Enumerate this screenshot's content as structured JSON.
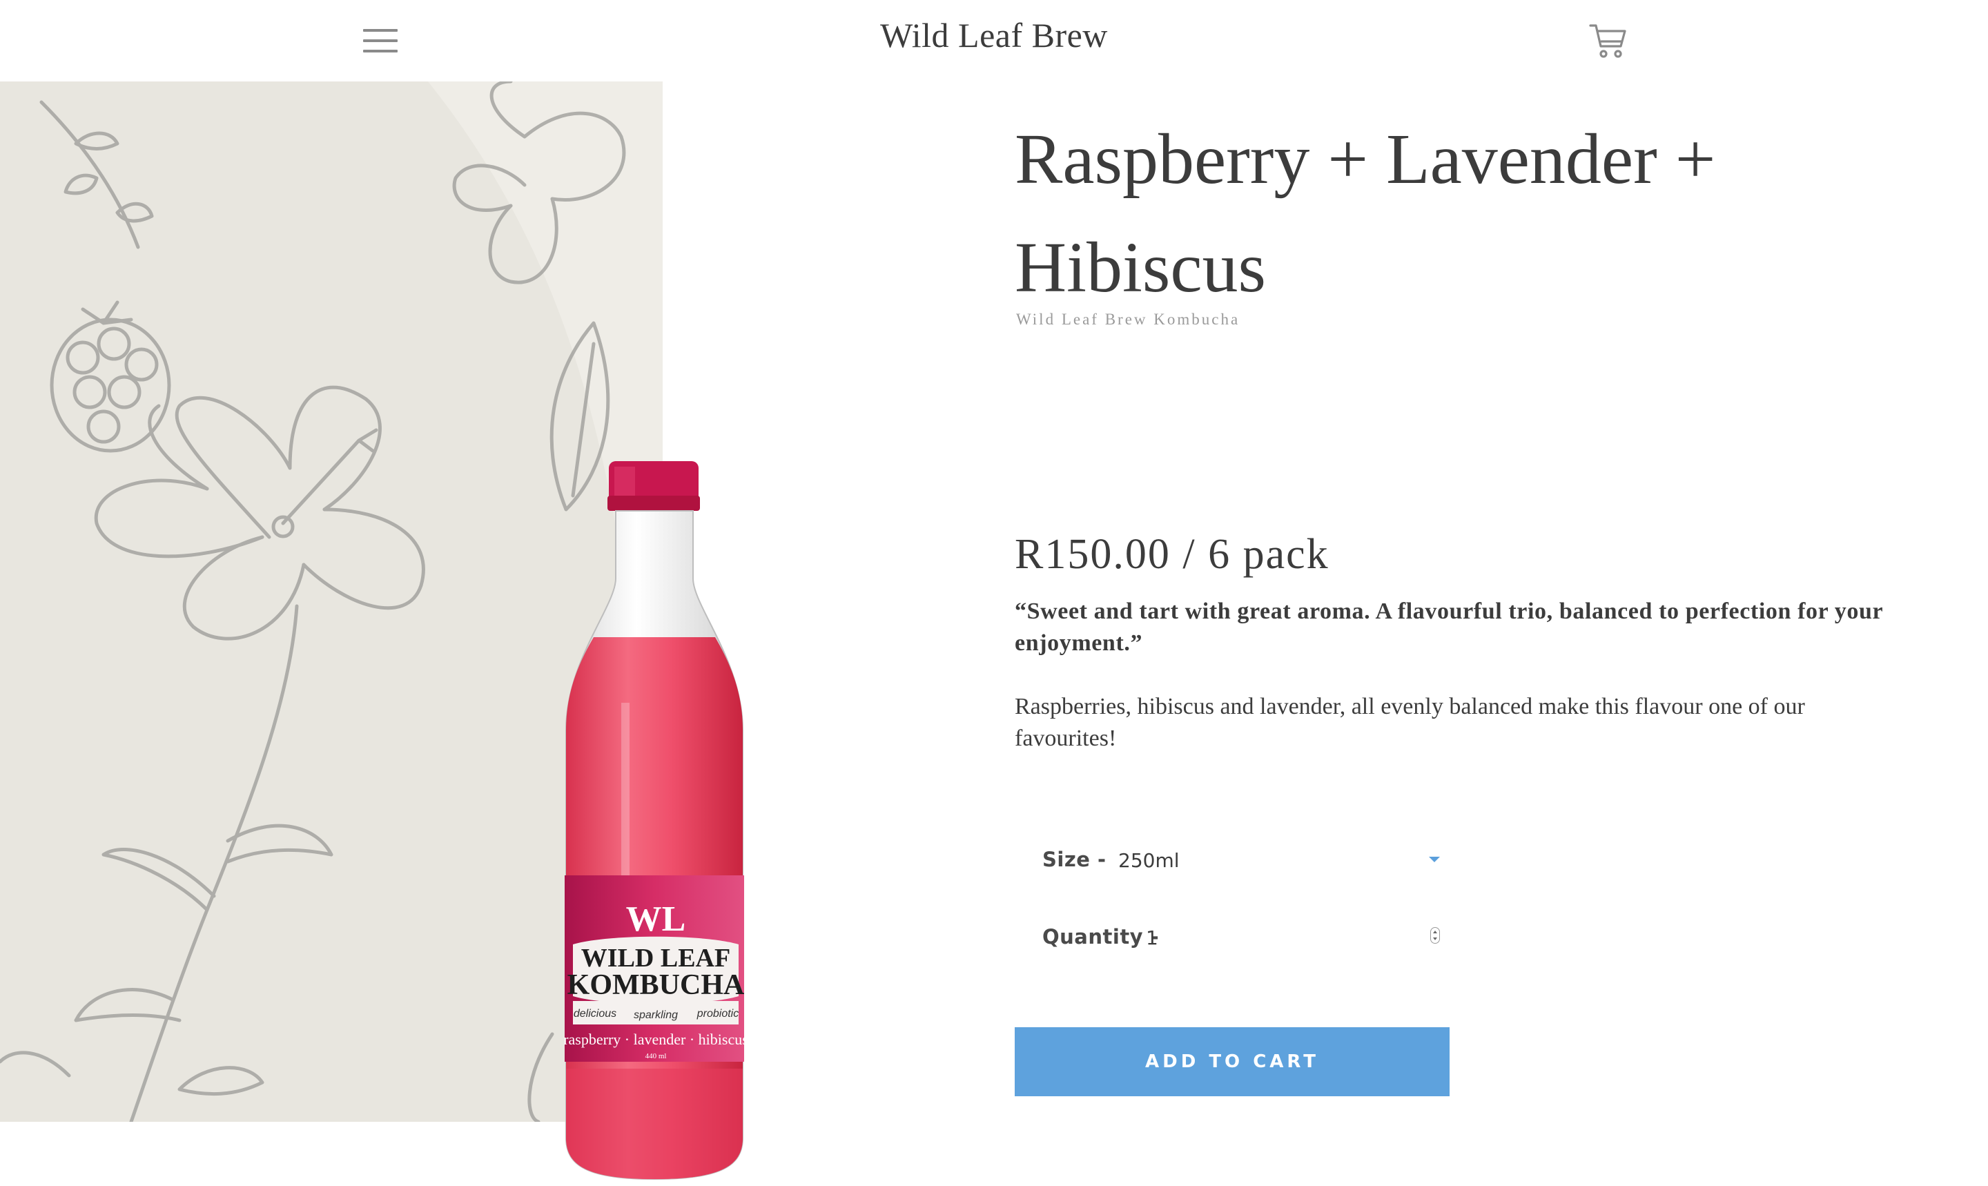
{
  "header": {
    "logo_text": "Wild Leaf Brew",
    "menu_icon": "hamburger-menu-icon",
    "cart_icon": "shopping-cart-icon"
  },
  "product": {
    "title": "Raspberry + Lavender + Hibiscus",
    "vendor": "Wild Leaf Brew Kombucha",
    "price": "R150.00 / 6 pack",
    "quote": "“Sweet and tart with great aroma. A flavourful trio, balanced to perfection for your enjoyment.”",
    "description": "Raspberries, hibiscus and lavender, all evenly balanced make this flavour one of our favourites!",
    "image": {
      "bottle_brand_mark": "WL",
      "bottle_brand_line1": "WILD LEAF",
      "bottle_brand_line2": "KOMBUCHA",
      "bottle_tags": [
        "delicious",
        "sparkling",
        "probiotic"
      ],
      "bottle_flavour": "raspberry · lavender · hibiscus",
      "bottle_volume": "440 ml"
    }
  },
  "form": {
    "size_label": "Size -",
    "size_value": "250ml",
    "quantity_label": "Quantity -",
    "quantity_value": "1",
    "add_to_cart_label": "ADD TO CART"
  },
  "colors": {
    "accent": "#5ea2dd",
    "text": "#3c3c3c",
    "image_background": "#e8e6df",
    "bottle_liquid": "#ee4f6a",
    "bottle_cap": "#c8174f",
    "label": "#cf2863"
  }
}
